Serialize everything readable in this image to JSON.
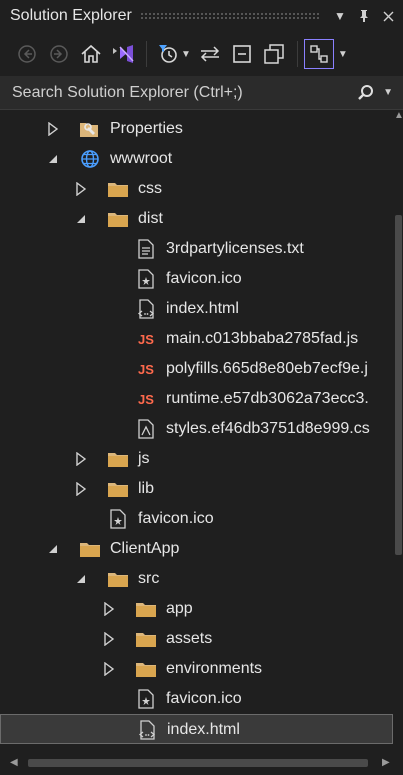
{
  "window": {
    "title": "Solution Explorer"
  },
  "search": {
    "placeholder": "Search Solution Explorer (Ctrl+;)"
  },
  "toolbar": {
    "icons": [
      "back-icon",
      "forward-icon",
      "home-icon",
      "vs-switch-views-icon",
      "pending-changes-filter-icon",
      "sync-arrows-icon",
      "collapse-all-icon",
      "show-all-files-icon",
      "track-active-item-icon"
    ]
  },
  "tree": {
    "items": [
      {
        "label": "Properties",
        "level": 0,
        "expand": "collapsed",
        "icon": "properties-icon"
      },
      {
        "label": "wwwroot",
        "level": 0,
        "expand": "expanded",
        "icon": "globe-icon"
      },
      {
        "label": "css",
        "level": 1,
        "expand": "collapsed",
        "icon": "folder-icon"
      },
      {
        "label": "dist",
        "level": 1,
        "expand": "expanded",
        "icon": "folder-icon"
      },
      {
        "label": "3rdpartylicenses.txt",
        "level": 2,
        "expand": "none",
        "icon": "text-file-icon"
      },
      {
        "label": "favicon.ico",
        "level": 2,
        "expand": "none",
        "icon": "image-file-icon"
      },
      {
        "label": "index.html",
        "level": 2,
        "expand": "none",
        "icon": "html-file-icon"
      },
      {
        "label": "main.c013bbaba2785fad.js",
        "level": 2,
        "expand": "none",
        "icon": "js-file-icon"
      },
      {
        "label": "polyfills.665d8e80eb7ecf9e.j",
        "level": 2,
        "expand": "none",
        "icon": "js-file-icon"
      },
      {
        "label": "runtime.e57db3062a73ecc3.",
        "level": 2,
        "expand": "none",
        "icon": "js-file-icon"
      },
      {
        "label": "styles.ef46db3751d8e999.cs",
        "level": 2,
        "expand": "none",
        "icon": "css-file-icon"
      },
      {
        "label": "js",
        "level": 1,
        "expand": "collapsed",
        "icon": "folder-icon"
      },
      {
        "label": "lib",
        "level": 1,
        "expand": "collapsed",
        "icon": "folder-icon"
      },
      {
        "label": "favicon.ico",
        "level": 1,
        "expand": "none",
        "icon": "image-file-icon"
      },
      {
        "label": "ClientApp",
        "level": 0,
        "expand": "expanded",
        "icon": "folder-icon"
      },
      {
        "label": "src",
        "level": 1,
        "expand": "expanded",
        "icon": "folder-icon"
      },
      {
        "label": "app",
        "level": 2,
        "expand": "collapsed",
        "icon": "folder-icon"
      },
      {
        "label": "assets",
        "level": 2,
        "expand": "collapsed",
        "icon": "folder-icon"
      },
      {
        "label": "environments",
        "level": 2,
        "expand": "collapsed",
        "icon": "folder-icon"
      },
      {
        "label": "favicon.ico",
        "level": 2,
        "expand": "none",
        "icon": "image-file-icon"
      },
      {
        "label": "index.html",
        "level": 2,
        "expand": "none",
        "icon": "html-file-icon",
        "selected": true
      }
    ]
  }
}
